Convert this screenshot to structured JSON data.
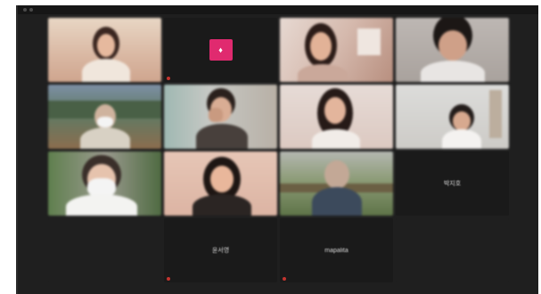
{
  "meeting": {
    "participants": [
      {
        "id": "p1",
        "kind": "video"
      },
      {
        "id": "p2",
        "kind": "avatar",
        "avatar_color": "#e02a6f"
      },
      {
        "id": "p3",
        "kind": "video"
      },
      {
        "id": "p4",
        "kind": "video"
      },
      {
        "id": "p5",
        "kind": "video"
      },
      {
        "id": "p6",
        "kind": "video"
      },
      {
        "id": "p7",
        "kind": "video"
      },
      {
        "id": "p8",
        "kind": "video"
      },
      {
        "id": "p9",
        "kind": "video"
      },
      {
        "id": "p10",
        "kind": "video"
      },
      {
        "id": "p11",
        "kind": "video"
      },
      {
        "id": "p12",
        "kind": "name",
        "name": "박지호"
      },
      {
        "id": "p13",
        "kind": "name",
        "name": "윤서영"
      },
      {
        "id": "p14",
        "kind": "name",
        "name": "mapalita"
      }
    ]
  }
}
